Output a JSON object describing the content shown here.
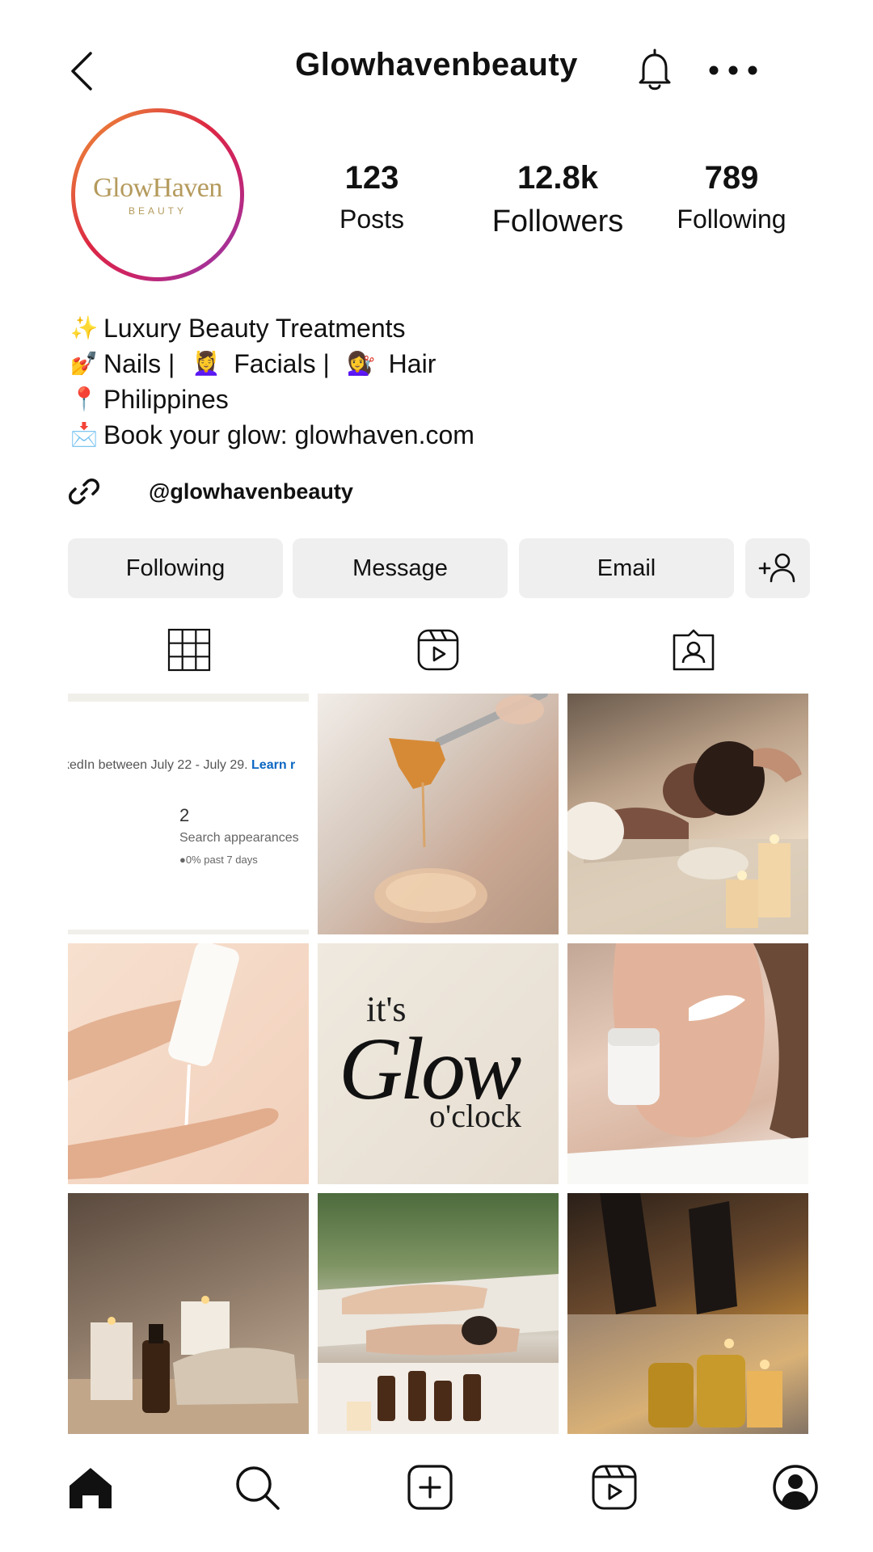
{
  "header": {
    "title": "Glowhavenbeauty",
    "icons": [
      "chevron-left-icon",
      "bell-icon",
      "more-horizontal-icon"
    ]
  },
  "profile": {
    "avatar_logo": {
      "main": "GlowHaven",
      "sub": "BEAUTY"
    },
    "stats": {
      "posts": {
        "value": "123",
        "label": "Posts"
      },
      "followers": {
        "value": "12.8k",
        "label": "Followers"
      },
      "following": {
        "value": "789",
        "label": "Following"
      }
    },
    "bio": {
      "line1": {
        "emoji": "✨",
        "text": "Luxury Beauty Treatments"
      },
      "line2": {
        "emoji1": "💅",
        "text1": "Nails | ",
        "emoji2": "💆‍♀️",
        "text2": "Facials | ",
        "emoji3": "💇‍♀️",
        "text3": "Hair"
      },
      "line3": {
        "emoji": "📍",
        "text": "Philippines"
      },
      "line4": {
        "emoji": "📩",
        "text": "Book your glow: glowhaven.com"
      }
    },
    "link_handle": "@glowhavenbeauty"
  },
  "actions": {
    "following": "Following",
    "message": "Message",
    "email": "Email"
  },
  "tabs": [
    "grid-icon",
    "reels-icon",
    "tagged-icon"
  ],
  "grid": {
    "tile1": {
      "text": "kedIn between July 22 - July 29.",
      "learn": "Learn r",
      "number": "2",
      "label": "Search appearances",
      "sub": "●0% past 7 days"
    },
    "tile5": {
      "its": "it's",
      "glow": "Glow",
      "clock": "o'clock"
    }
  },
  "bottom_nav": [
    "home-icon",
    "search-icon",
    "create-icon",
    "reels-icon",
    "profile-icon"
  ]
}
